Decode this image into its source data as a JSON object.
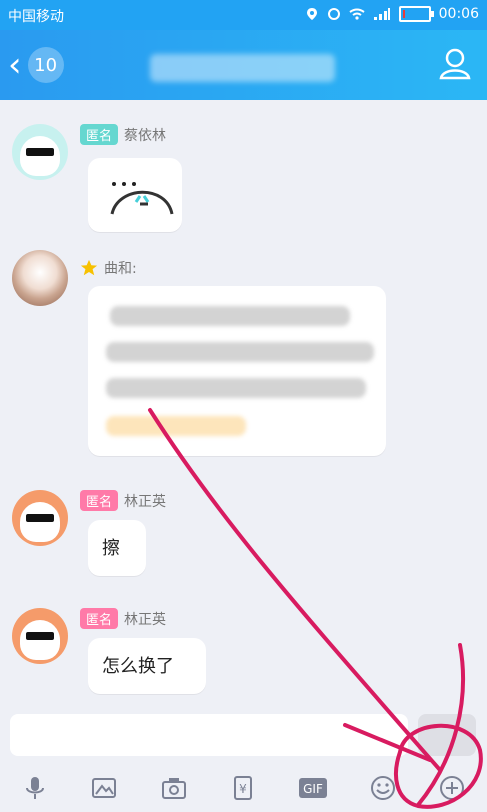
{
  "status_bar": {
    "carrier": "中国移动",
    "time": "00:06",
    "battery_level": 0.1,
    "battery_color": "#e83b3b"
  },
  "header": {
    "unread_count": "10",
    "icons": {
      "back": "chevron-left-icon",
      "profile": "user-icon"
    },
    "accent": "#22a3f3"
  },
  "messages": [
    {
      "tag": "匿名",
      "sender": "蔡依林",
      "type": "sticker"
    },
    {
      "sender": "曲和:",
      "type": "text-blurred",
      "has_star": true
    },
    {
      "tag": "匿名",
      "sender": "林正英",
      "text": "擦"
    },
    {
      "tag": "匿名",
      "sender": "林正英",
      "text": "怎么换了"
    }
  ],
  "input": {
    "value": "",
    "placeholder": ""
  },
  "toolbar": {
    "icons": [
      "microphone-icon",
      "image-icon",
      "camera-icon",
      "red-packet-icon",
      "gif-icon",
      "emoji-icon",
      "plus-icon"
    ],
    "gif_label": "GIF",
    "currency_label": "¥"
  },
  "annotation_color": "#d81b60"
}
